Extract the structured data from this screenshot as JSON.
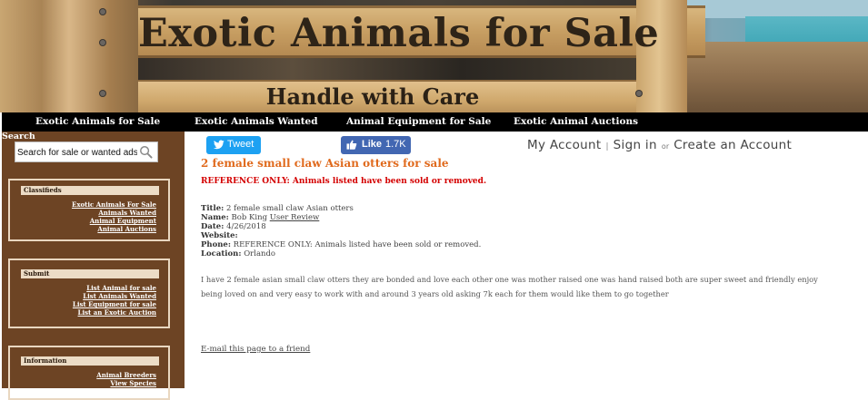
{
  "banner": {
    "title": "Exotic Animals for Sale",
    "subtitle": "Handle with Care"
  },
  "topnav": {
    "items": [
      {
        "label": "Exotic Animals for Sale"
      },
      {
        "label": "Exotic Animals Wanted"
      },
      {
        "label": "Animal Equipment for Sale"
      },
      {
        "label": "Exotic Animal Auctions"
      }
    ]
  },
  "sidebar": {
    "search_label": "Search",
    "search_placeholder": "Search for sale or wanted ads",
    "boxes": [
      {
        "heading": "Classifieds",
        "links": [
          "Exotic Animals For Sale",
          "Animals Wanted",
          "Animal Equipment",
          "Animal Auctions"
        ]
      },
      {
        "heading": "Submit",
        "links": [
          "List Animal for sale",
          "List Animals Wanted",
          "List Equipment for sale",
          "List an Exotic Auction"
        ]
      },
      {
        "heading": "Information",
        "links": [
          "Animal Breeders",
          "View Species"
        ]
      }
    ]
  },
  "social": {
    "tweet_label": "Tweet",
    "like_label": "Like",
    "like_count": "1.7K"
  },
  "account": {
    "my_account": "My Account",
    "separator": "|",
    "sign_in": "Sign in",
    "or": "or",
    "create_account": "Create an Account"
  },
  "listing": {
    "title": "2 female small claw Asian otters for sale",
    "notice": "REFERENCE ONLY: Animals listed have been sold or removed.",
    "details": {
      "title_key": "Title:",
      "title_val": "2 female small claw Asian otters",
      "name_key": "Name:",
      "name_val": "Bob King",
      "user_review": "User Review",
      "date_key": "Date:",
      "date_val": "4/26/2018",
      "website_key": "Website:",
      "website_val": "",
      "phone_key": "Phone:",
      "phone_val": "REFERENCE ONLY: Animals listed have been sold or removed.",
      "location_key": "Location:",
      "location_val": "Orlando"
    },
    "description": "I have 2 female asian small claw otters they are bonded and love each other one was mother raised one was hand raised both are super sweet and friendly enjoy being loved on and very easy to work with and around 3 years old asking 7k each for them would like them to go together",
    "email_friend": "E-mail this page to a friend"
  },
  "colors": {
    "nav_bg": "#000000",
    "sidebar_bg": "#6d4424",
    "title_orange": "#e06a1d",
    "notice_red": "#d40000",
    "tweet_blue": "#1da1f2",
    "like_blue": "#4267b2"
  }
}
